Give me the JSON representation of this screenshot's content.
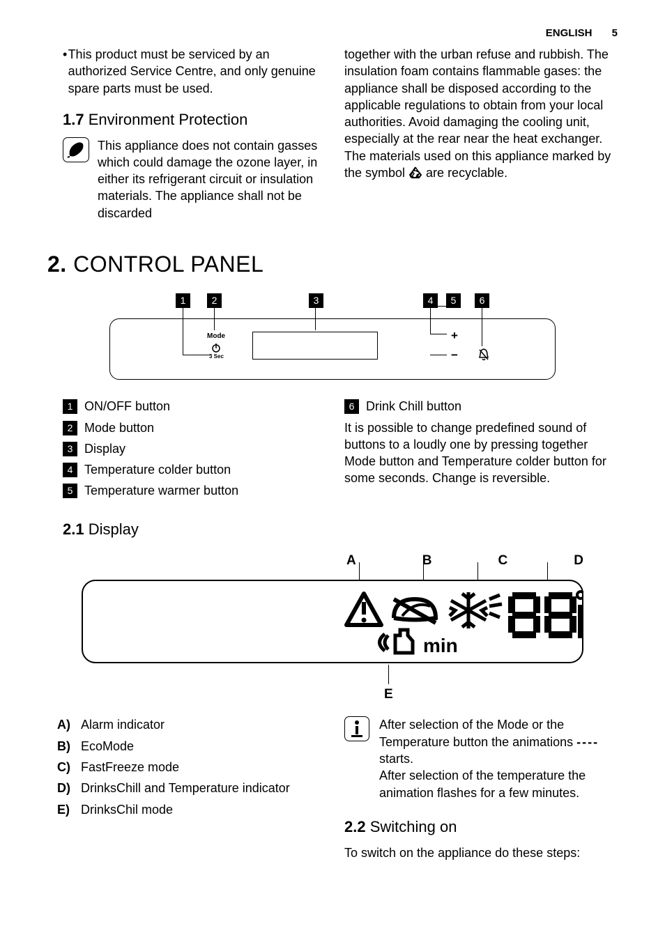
{
  "header": {
    "lang": "ENGLISH",
    "page": "5"
  },
  "top": {
    "bullet": "This product must be serviced by an authorized Service Centre, and only genuine spare parts must be used.",
    "s17_title_num": "1.7",
    "s17_title": " Environment Protection",
    "env_text": "This appliance does not contain gasses which could damage the ozone layer, in either its refrigerant circuit or insulation materials. The appliance shall not be discarded",
    "col2a": "together with the urban refuse and rubbish. The insulation foam contains flammable gases: the appliance shall be disposed according to the applicable regulations to obtain from your local authorities. Avoid damaging the cooling unit, especially at the rear near the heat exchanger. The materials used on this appliance marked by the symbol ",
    "col2b": " are recyclable."
  },
  "s2": {
    "num": "2.",
    "title": " CONTROL PANEL",
    "legend": {
      "1": "ON/OFF button",
      "2": "Mode button",
      "3": "Display",
      "4": "Temperature colder button",
      "5": "Temperature warmer button",
      "6": "Drink Chill button"
    },
    "note": "It is possible to change predefined sound of buttons to a loudly one by pressing together Mode button and Temperature colder button for some seconds. Change is reversible."
  },
  "s21": {
    "num": "2.1",
    "title": " Display",
    "labels": {
      "A": "A",
      "B": "B",
      "C": "C",
      "D": "D",
      "E": "E"
    },
    "items": {
      "A": "Alarm indicator",
      "B": "EcoMode",
      "C": "FastFreeze mode",
      "D": "DrinksChill and Temperature indicator",
      "E": "DrinksChil mode"
    },
    "info1": "After selection of the Mode or the Temperature button the animations ",
    "dashes": "- - - -",
    "info1b": " starts.",
    "info2": "After selection of the temperature the animation flashes for a few minutes."
  },
  "s22": {
    "num": "2.2",
    "title": " Switching on",
    "text": "To switch on the appliance do these steps:"
  },
  "diagram": {
    "mode": "Mode",
    "sec3": "3 Sec",
    "min": "min"
  }
}
